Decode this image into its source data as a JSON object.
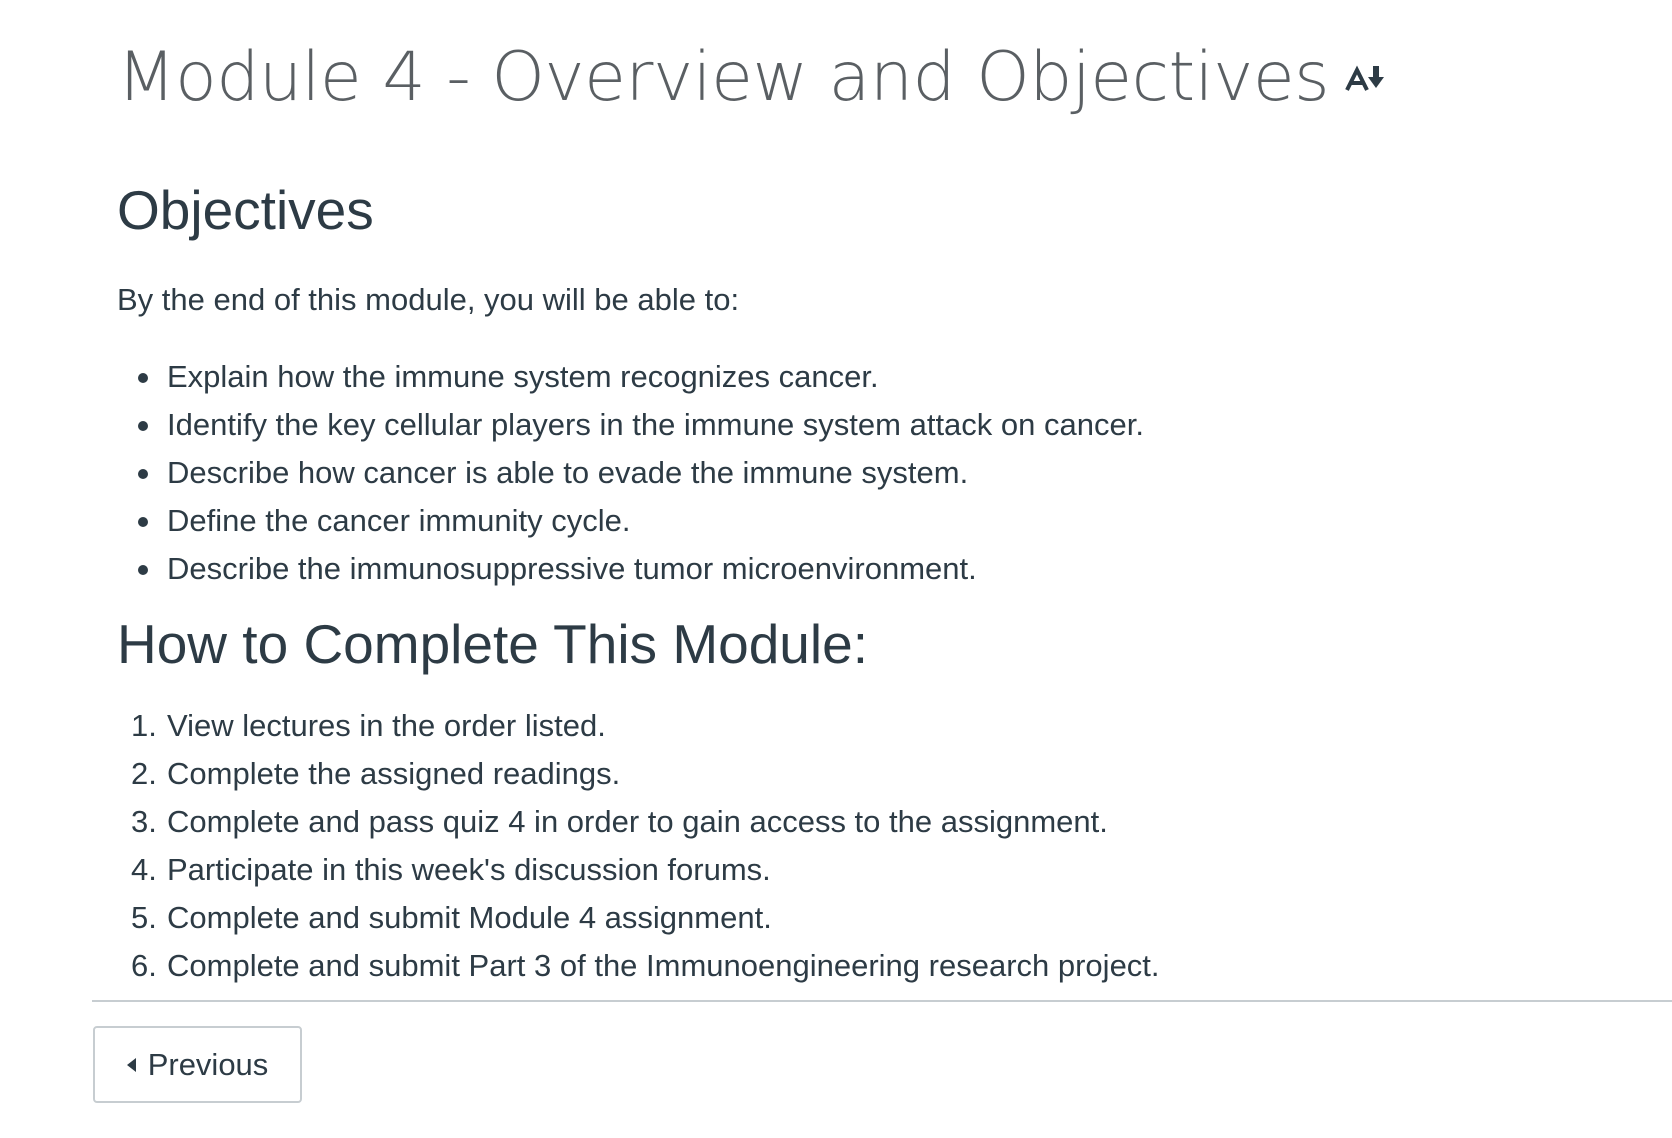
{
  "page": {
    "title": "Module 4 - Overview and Objectives",
    "accessibility_icon": "text-download-icon"
  },
  "objectives": {
    "heading": "Objectives",
    "intro": "By the end of this module, you will be able to:",
    "items": [
      "Explain how the immune system recognizes cancer.",
      "Identify the key cellular players in the immune system attack on cancer.",
      "Describe how cancer is able to evade the immune system.",
      "Define the cancer immunity cycle.",
      "Describe the immunosuppressive tumor microenvironment."
    ]
  },
  "how_to": {
    "heading": "How to Complete This Module:",
    "steps": [
      {
        "num": "1.",
        "text": "View lectures in the order listed."
      },
      {
        "num": "2.",
        "text": "Complete the assigned readings."
      },
      {
        "num": "3.",
        "text": "Complete and pass quiz 4 in order to gain access to the assignment."
      },
      {
        "num": "4.",
        "text": "Participate in this week's discussion forums."
      },
      {
        "num": "5.",
        "text": "Complete and submit Module 4 assignment."
      },
      {
        "num": "6.",
        "text": "Complete and submit Part 3 of the Immunoengineering research project."
      }
    ]
  },
  "navigation": {
    "previous_label": "Previous"
  },
  "colors": {
    "text": "#2d3b45",
    "title": "#5a5f63",
    "border": "#c7cdd1"
  }
}
